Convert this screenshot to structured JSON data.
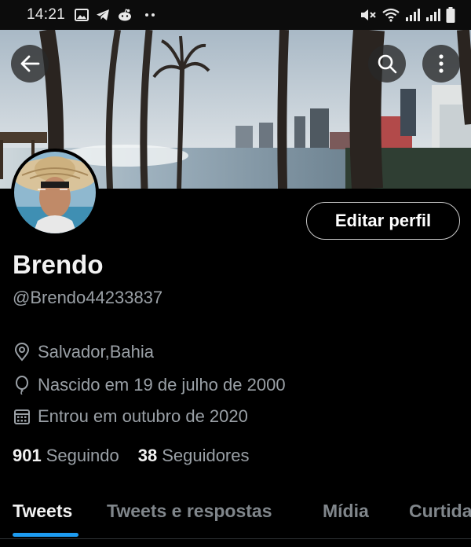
{
  "status_bar": {
    "time": "14:21",
    "left_icons": [
      "image-icon",
      "telegram-icon",
      "reddit-icon",
      "more-dots-icon"
    ],
    "right_icons": [
      "mute-icon",
      "wifi-icon",
      "signal-icon",
      "signal-icon",
      "battery-icon"
    ]
  },
  "header": {
    "back_icon": "arrow-left-icon",
    "search_icon": "search-icon",
    "more_icon": "more-vertical-icon"
  },
  "profile": {
    "edit_button": "Editar perfil",
    "name": "Brendo",
    "handle": "@Brendo44233837",
    "location": "Salvador,Bahia",
    "birth": "Nascido em 19 de julho de 2000",
    "joined": "Entrou em outubro de 2020",
    "following_count": "901",
    "following_label": "Seguindo",
    "followers_count": "38",
    "followers_label": "Seguidores"
  },
  "tabs": [
    {
      "label": "Tweets",
      "active": true
    },
    {
      "label": "Tweets e respostas",
      "active": false
    },
    {
      "label": "Mídia",
      "active": false
    },
    {
      "label": "Curtidas",
      "active": false
    }
  ],
  "colors": {
    "accent": "#1d9bf0",
    "background": "#000000",
    "secondary_text": "#9aa0a6"
  }
}
